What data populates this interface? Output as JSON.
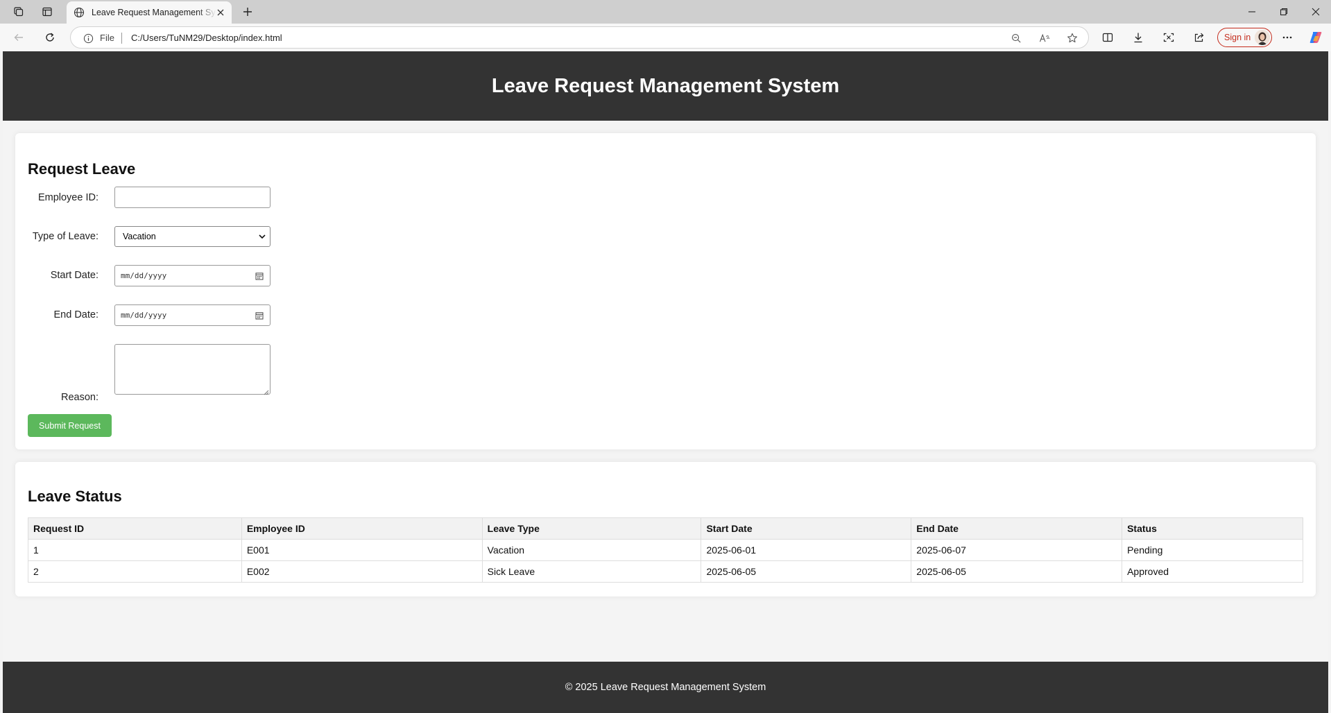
{
  "browser": {
    "tab_title": "Leave Request Management System",
    "file_label": "File",
    "url": "C:/Users/TuNM29/Desktop/index.html",
    "sign_in_label": "Sign in"
  },
  "header": {
    "title": "Leave Request Management System"
  },
  "request_form": {
    "heading": "Request Leave",
    "employee_id_label": "Employee ID:",
    "employee_id_value": "",
    "leave_type_label": "Type of Leave:",
    "leave_type_selected": "Vacation",
    "start_date_label": "Start Date:",
    "start_date_placeholder": "mm/dd/yyyy",
    "end_date_label": "End Date:",
    "end_date_placeholder": "mm/dd/yyyy",
    "reason_label": "Reason:",
    "reason_value": "",
    "submit_label": "Submit Request"
  },
  "leave_status": {
    "heading": "Leave Status",
    "columns": [
      "Request ID",
      "Employee ID",
      "Leave Type",
      "Start Date",
      "End Date",
      "Status"
    ],
    "rows": [
      [
        "1",
        "E001",
        "Vacation",
        "2025-06-01",
        "2025-06-07",
        "Pending"
      ],
      [
        "2",
        "E002",
        "Sick Leave",
        "2025-06-05",
        "2025-06-05",
        "Approved"
      ]
    ]
  },
  "footer": {
    "text": "© 2025 Leave Request Management System"
  },
  "colors": {
    "header_bg": "#333333",
    "submit_bg": "#5cb85c",
    "sign_in_accent": "#c42b1c"
  }
}
